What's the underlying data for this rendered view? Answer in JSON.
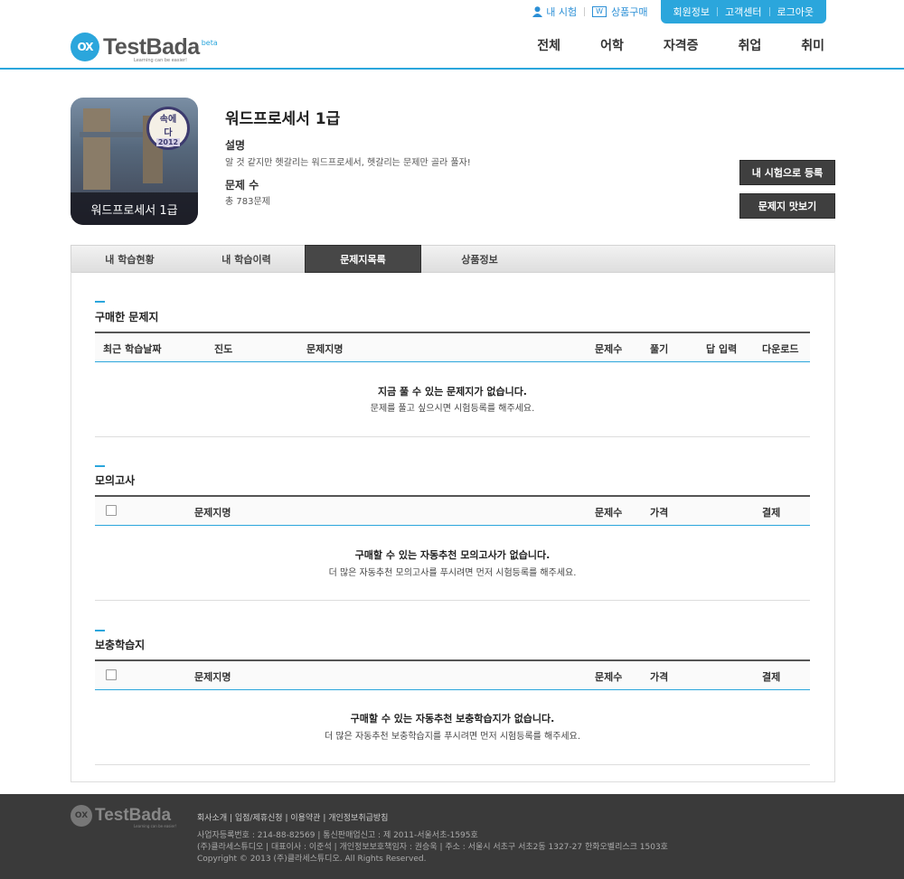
{
  "header": {
    "util": {
      "my_exam": "내 시험",
      "buy": "상품구매",
      "buy_badge": "W"
    },
    "member": {
      "info": "회원정보",
      "cs": "고객센터",
      "logout": "로그아웃"
    },
    "logo": {
      "mark": "OX",
      "name": "TestBada",
      "beta": "beta",
      "tagline": "Learning can be easier!"
    },
    "nav": [
      "전체",
      "어학",
      "자격증",
      "취업",
      "취미"
    ]
  },
  "product": {
    "thumb_badge_top": "속에",
    "thumb_badge_mid": "다",
    "thumb_badge_year": "2012",
    "thumb_caption": "워드프로세서 1급",
    "title": "워드프로세서 1급",
    "desc_label": "설명",
    "desc": "알 것 같지만 헷갈리는 워드프로세서, 헷갈리는 문제만 골라 풀자!",
    "count_label": "문제 수",
    "count": "총 783문제",
    "register_button": "내 시험으로 등록",
    "preview_button": "문제지 맛보기"
  },
  "tabs": [
    "내 학습현황",
    "내 학습이력",
    "문제지목록",
    "상품정보"
  ],
  "sections": {
    "purchased": {
      "title": "구매한 문제지",
      "columns": [
        "최근 학습날짜",
        "진도",
        "문제지명",
        "문제수",
        "풀기",
        "답 입력",
        "다운로드"
      ],
      "empty_bold": "지금 풀 수 있는 문제지가 없습니다.",
      "empty_note": "문제를 풀고 싶으시면 시험등록를 해주세요."
    },
    "mock": {
      "title": "모의고사",
      "columns": [
        "문제지명",
        "문제수",
        "가격",
        "결제"
      ],
      "empty_bold": "구매할 수 있는 자동추천 모의고사가 없습니다.",
      "empty_note": "더 많은 자동추천 모의고사를 푸시려면 먼저 시험등록를 해주세요."
    },
    "supplement": {
      "title": "보충학습지",
      "columns": [
        "문제지명",
        "문제수",
        "가격",
        "결제"
      ],
      "empty_bold": "구매할 수 있는 자동추천 보충학습지가 없습니다.",
      "empty_note": "더 많은 자동추천 보충학습지를 푸시려면 먼저 시험등록를 해주세요."
    }
  },
  "footer": {
    "logo_mark": "OX",
    "logo_name": "TestBada",
    "logo_tag": "Learning can be easier!",
    "links": "회사소개 | 입점/제휴신청 | 이용약관 | 개인정보취급방침",
    "line1": "사업자등록번호 : 214-88-82569   |   통신판매업신고 : 제 2011-서울서초-1595호",
    "line2": "(주)클라세스튜디오   |   대표이사 : 이준석   |   개인정보보호책임자 : 권승욱   |   주소 : 서울시 서초구 서초2동 1327-27 한화오벨리스크 1503호",
    "line3": "Copyright © 2013 (주)클라세스튜디오. All Rights Reserved."
  },
  "colors": {
    "accent": "#2ba6dc",
    "dark_button": "#3f3f3f",
    "footer_bg": "#3a3a3a"
  }
}
